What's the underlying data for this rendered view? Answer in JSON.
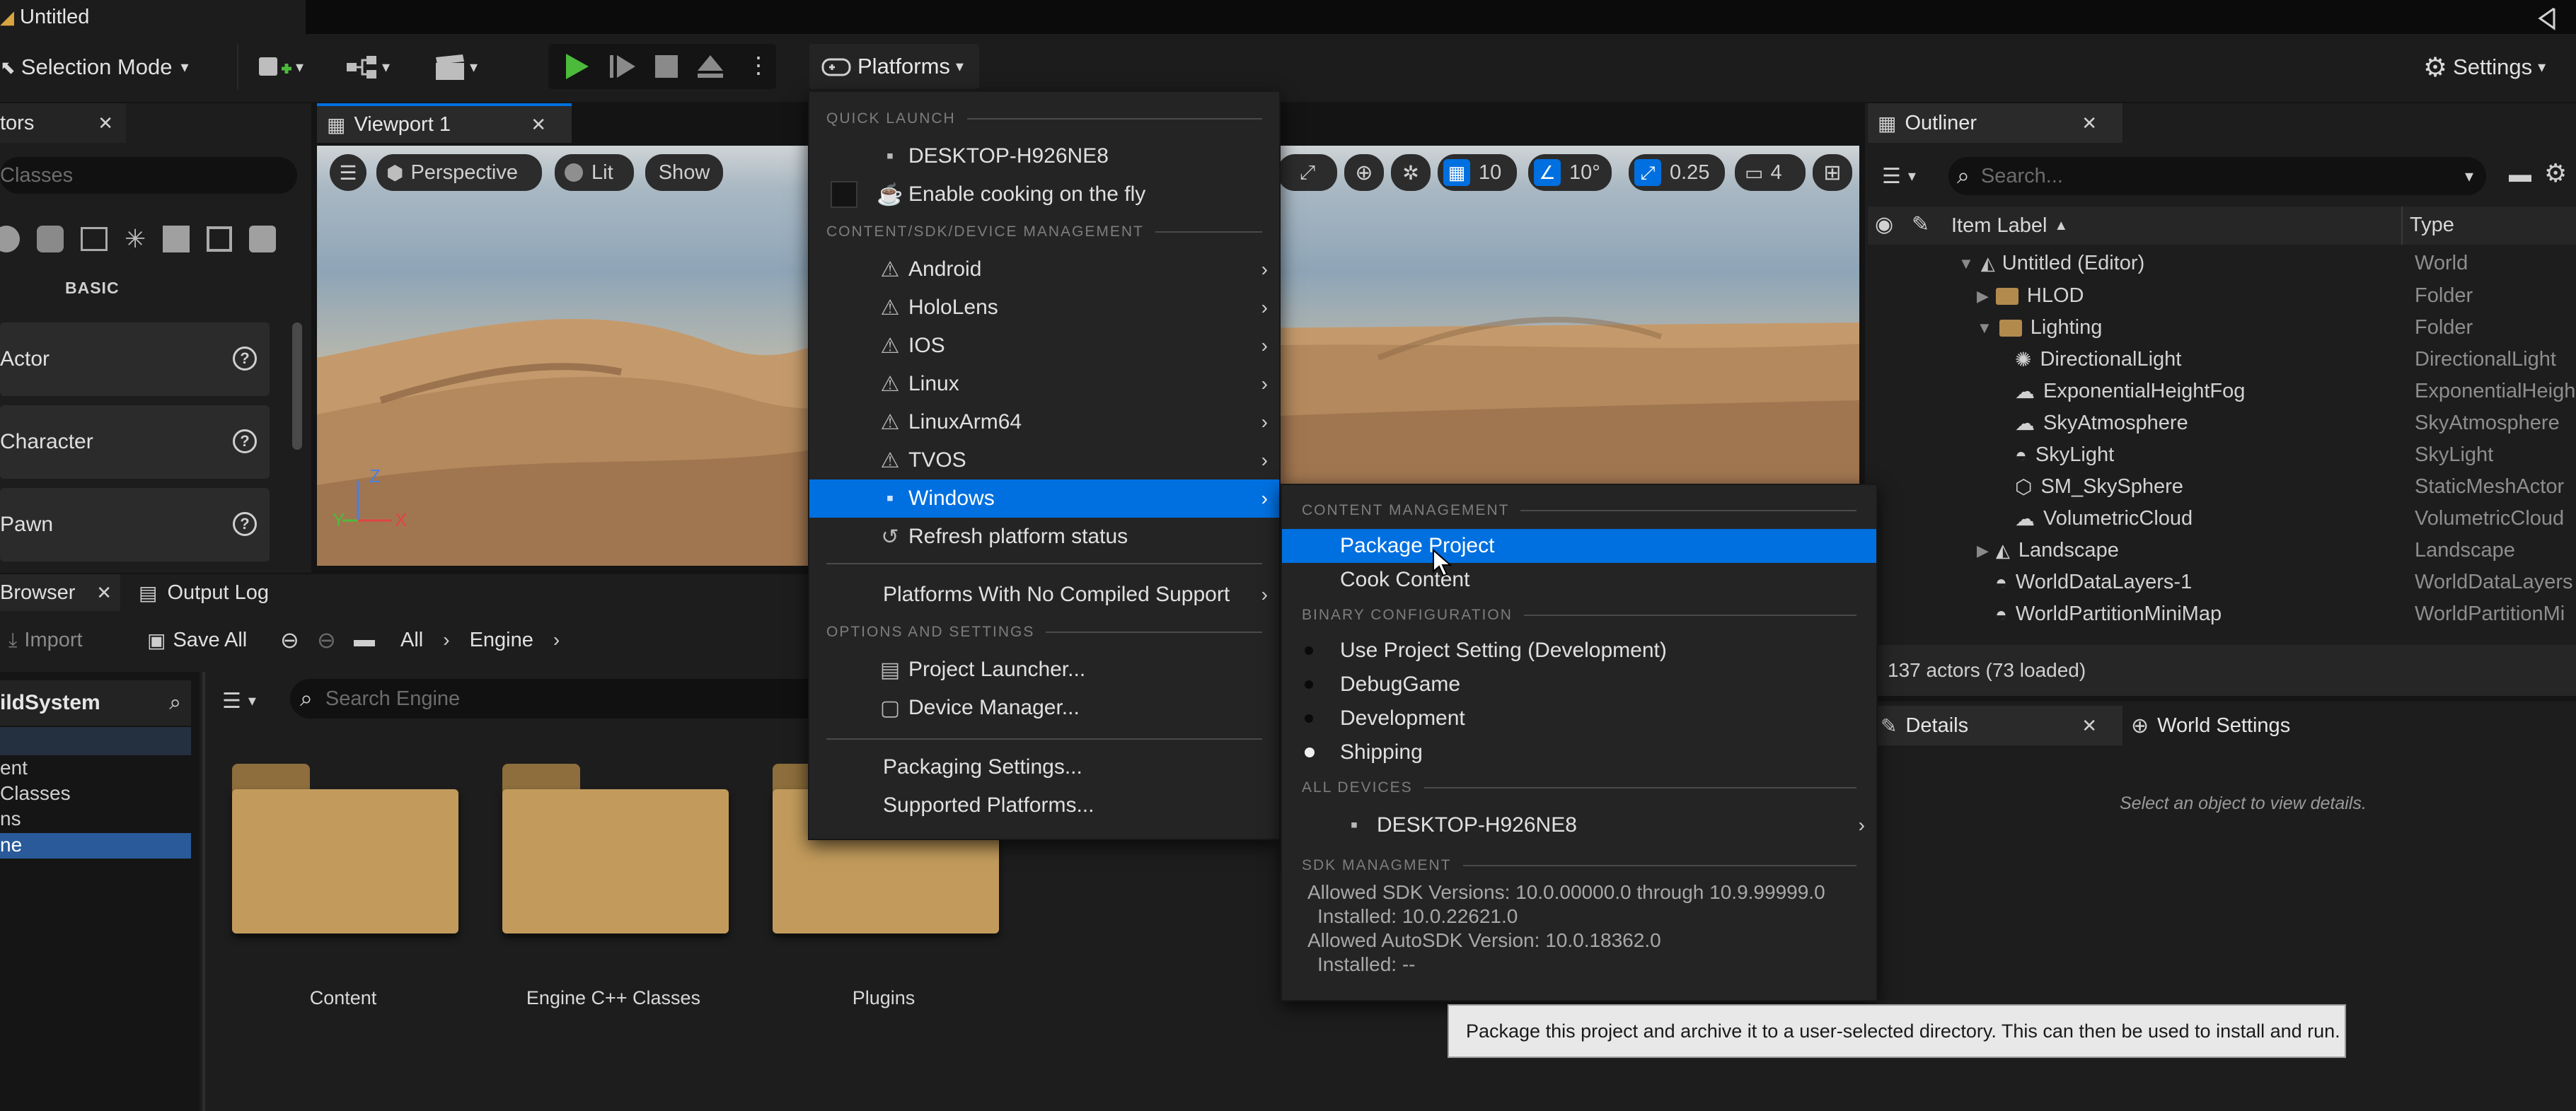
{
  "window": {
    "tab_title": "Untitled"
  },
  "toolbar": {
    "mode_label": "Selection Mode",
    "platforms_label": "Platforms",
    "settings_label": "Settings"
  },
  "place_actors": {
    "tab_label": "tors",
    "search_placeholder": "Classes",
    "section_label": "BASIC",
    "items": [
      "Actor",
      "Character",
      "Pawn"
    ]
  },
  "viewport": {
    "tab_label": "Viewport 1",
    "perspective_label": "Perspective",
    "lit_label": "Lit",
    "show_label": "Show",
    "grid_snap": "10",
    "rotation_snap": "10°",
    "scale_snap": "0.25",
    "camera_speed": "4",
    "axes": {
      "x": "X",
      "y": "Y",
      "z": "Z"
    }
  },
  "content_browser": {
    "tab_label": "Browser",
    "output_log_label": "Output Log",
    "import_label": "Import",
    "save_all_label": "Save All",
    "crumb_all": "All",
    "crumb_engine": "Engine",
    "source_root": "ildSystem",
    "tree_items": [
      "ent",
      "Classes",
      "ns",
      "ne"
    ],
    "search_placeholder": "Search Engine",
    "folders": [
      "Content",
      "Engine C++ Classes",
      "Plugins"
    ]
  },
  "platforms_menu": {
    "quick_launch_header": "QUICK LAUNCH",
    "device_label": "DESKTOP-H926NE8",
    "cooking_label": "Enable cooking on the fly",
    "sdk_header": "CONTENT/SDK/DEVICE MANAGEMENT",
    "platforms": [
      "Android",
      "HoloLens",
      "IOS",
      "Linux",
      "LinuxArm64",
      "TVOS",
      "Windows"
    ],
    "refresh_label": "Refresh platform status",
    "no_compiled_label": "Platforms With No Compiled Support",
    "options_header": "OPTIONS AND SETTINGS",
    "project_launcher_label": "Project Launcher...",
    "device_manager_label": "Device Manager...",
    "packaging_settings_label": "Packaging Settings...",
    "supported_platforms_label": "Supported Platforms..."
  },
  "windows_submenu": {
    "content_header": "CONTENT MANAGEMENT",
    "package_label": "Package Project",
    "cook_label": "Cook Content",
    "binary_header": "BINARY CONFIGURATION",
    "configs": [
      "Use Project Setting (Development)",
      "DebugGame",
      "Development",
      "Shipping"
    ],
    "selected_config": "Shipping",
    "all_devices_header": "ALL DEVICES",
    "device_label": "DESKTOP-H926NE8",
    "sdk_header": "SDK MANAGMENT",
    "sdk_lines": [
      "Allowed SDK Versions: 10.0.00000.0 through 10.9.99999.0",
      "Installed: 10.0.22621.0",
      "Allowed AutoSDK Version: 10.0.18362.0",
      "Installed: --"
    ]
  },
  "tooltip": {
    "text": "Package this project and archive it to a user-selected directory. This can then be used to install and run."
  },
  "outliner": {
    "tab_label": "Outliner",
    "search_placeholder": "Search...",
    "col_label": "Item Label",
    "col_type": "Type",
    "rows": [
      {
        "label": "Untitled (Editor)",
        "type": "World"
      },
      {
        "label": "HLOD",
        "type": "Folder"
      },
      {
        "label": "Lighting",
        "type": "Folder"
      },
      {
        "label": "DirectionalLight",
        "type": "DirectionalLight"
      },
      {
        "label": "ExponentialHeightFog",
        "type": "ExponentialHeigh"
      },
      {
        "label": "SkyAtmosphere",
        "type": "SkyAtmosphere"
      },
      {
        "label": "SkyLight",
        "type": "SkyLight"
      },
      {
        "label": "SM_SkySphere",
        "type": "StaticMeshActor"
      },
      {
        "label": "VolumetricCloud",
        "type": "VolumetricCloud"
      },
      {
        "label": "Landscape",
        "type": "Landscape"
      },
      {
        "label": "WorldDataLayers-1",
        "type": "WorldDataLayers"
      },
      {
        "label": "WorldPartitionMiniMap",
        "type": "WorldPartitionMi"
      }
    ],
    "status": "137 actors (73 loaded)"
  },
  "details": {
    "tab_label": "Details",
    "world_settings_label": "World Settings",
    "empty_message": "Select an object to view details."
  },
  "colors": {
    "accent": "#0070e0",
    "play_green": "#4cbb3c",
    "folder": "#c29b5c"
  }
}
